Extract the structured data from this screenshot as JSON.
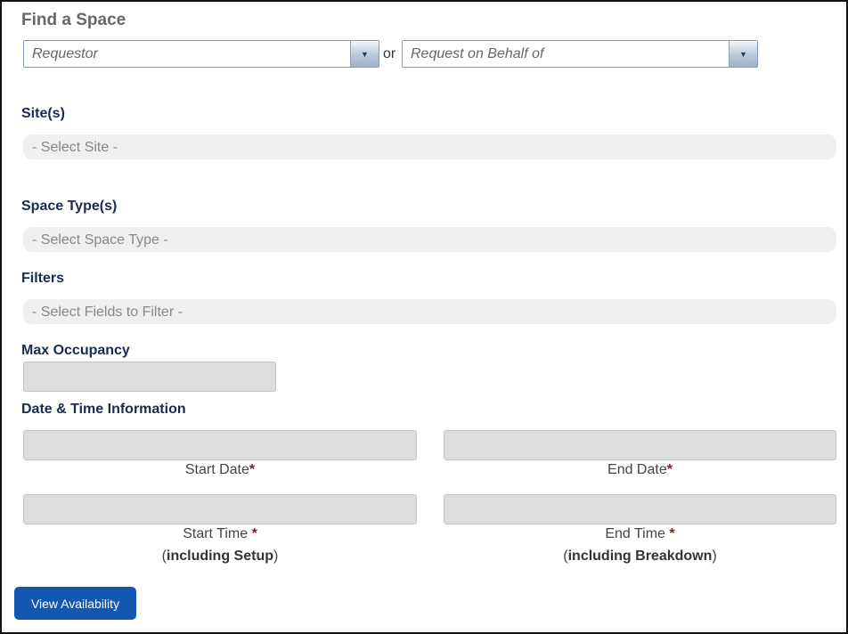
{
  "header": {
    "title": "Find a Space"
  },
  "requestor": {
    "requestor_placeholder": "Requestor",
    "or_label": "or",
    "behalf_placeholder": "Request on Behalf of"
  },
  "sites": {
    "label": "Site(s)",
    "placeholder": "- Select Site -"
  },
  "space_types": {
    "label": "Space Type(s)",
    "placeholder": "- Select Space Type -"
  },
  "filters": {
    "label": "Filters",
    "placeholder": "- Select Fields to Filter -"
  },
  "occupancy": {
    "label": "Max Occupancy",
    "value": ""
  },
  "datetime": {
    "label": "Date & Time Information",
    "start_date": "Start Date",
    "end_date": "End Date",
    "start_time": "Start Time",
    "start_time_note": "including Setup",
    "end_time": "End Time",
    "end_time_note": "including Breakdown",
    "required_mark": "*"
  },
  "actions": {
    "view_availability": "View Availability"
  }
}
